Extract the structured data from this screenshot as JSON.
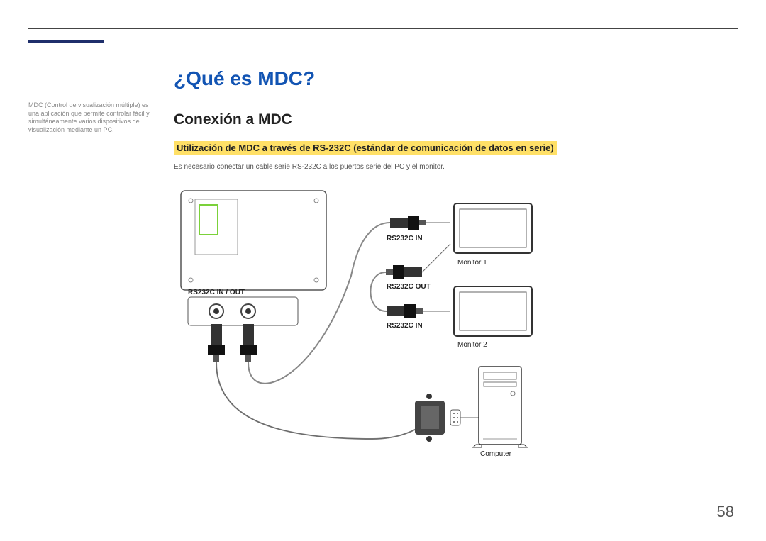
{
  "page_number": "58",
  "header": {
    "title": "¿Qué es MDC?",
    "subtitle": "Conexión a MDC",
    "section_title": "Utilización de MDC a través de RS-232C (estándar de comunicación de datos en serie)",
    "body": "Es necesario conectar un cable serie RS-232C a los puertos serie del PC y el monitor."
  },
  "sidebar": {
    "note": "MDC (Control de visualización múltiple) es una aplicación que permite controlar fácil y simultáneamente varios dispositivos de visualización mediante un PC."
  },
  "diagram": {
    "port_label": "RS232C IN / OUT",
    "label_in_top": "RS232C IN",
    "label_out": "RS232C OUT",
    "label_in_bottom": "RS232C IN",
    "monitor1": "Monitor 1",
    "monitor2": "Monitor 2",
    "computer": "Computer"
  }
}
